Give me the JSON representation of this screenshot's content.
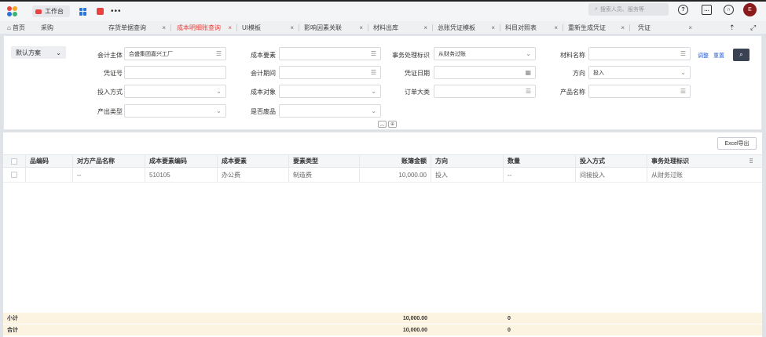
{
  "topbar": {
    "workbench_label": "工作台",
    "more_label": "•••",
    "search_placeholder": "搜索人员、服务等",
    "help_icon_label": "?",
    "avatar_initial": "E"
  },
  "tabs": [
    {
      "label": "首页",
      "closable": false
    },
    {
      "label": "采购",
      "closable": false
    },
    {
      "label": "存货单据查询",
      "closable": true
    },
    {
      "label": "成本明细账查询",
      "closable": true,
      "active": true
    },
    {
      "label": "UI模板",
      "closable": true
    },
    {
      "label": "影响因素关联",
      "closable": true
    },
    {
      "label": "材料出库",
      "closable": true
    },
    {
      "label": "总账凭证模板",
      "closable": true
    },
    {
      "label": "科目对照表",
      "closable": true
    },
    {
      "label": "重新生成凭证",
      "closable": true
    },
    {
      "label": "凭证",
      "closable": true
    }
  ],
  "filter": {
    "scheme_label": "默认方案",
    "fields": {
      "accounting_entity": {
        "label": "会计主体",
        "value": "合盛集团嘉兴工厂"
      },
      "cost_element": {
        "label": "成本要素",
        "value": ""
      },
      "business_flag": {
        "label": "事务处理标识",
        "value": "从财务过账"
      },
      "material_name": {
        "label": "材料名称",
        "value": ""
      },
      "voucher_no": {
        "label": "凭证号",
        "value": ""
      },
      "accounting_period": {
        "label": "会计期间",
        "value": ""
      },
      "voucher_date": {
        "label": "凭证日期",
        "value": ""
      },
      "direction": {
        "label": "方向",
        "value": "投入"
      },
      "input_method": {
        "label": "投入方式",
        "value": ""
      },
      "cost_object": {
        "label": "成本对象",
        "value": ""
      },
      "order_category": {
        "label": "订单大类",
        "value": ""
      },
      "product_name": {
        "label": "产品名称",
        "value": ""
      },
      "output_type": {
        "label": "产出类型",
        "value": ""
      },
      "is_scrap": {
        "label": "是否废品",
        "value": ""
      }
    },
    "adjust_label": "调整",
    "reset_label": "重置"
  },
  "grid": {
    "export_label": "Excel导出",
    "columns": [
      "品编码",
      "对方产品名称",
      "成本要素编码",
      "成本要素",
      "要素类型",
      "账簿金额",
      "方向",
      "数量",
      "投入方式",
      "事务处理标识"
    ],
    "rows": [
      [
        "",
        "--",
        "510105",
        "办公费",
        "制造费",
        "10,000.00",
        "投入",
        "--",
        "间接投入",
        "从财务过账"
      ]
    ],
    "subtotal": {
      "label": "小计",
      "amount": "10,000.00",
      "quantity": "0"
    },
    "total": {
      "label": "合计",
      "amount": "10,000.00",
      "quantity": "0"
    }
  },
  "colors": {
    "accent": "#e8433e",
    "primary_dark": "#3a4253",
    "link": "#2b5fd6",
    "summary_bg": "#fdf3e1"
  }
}
